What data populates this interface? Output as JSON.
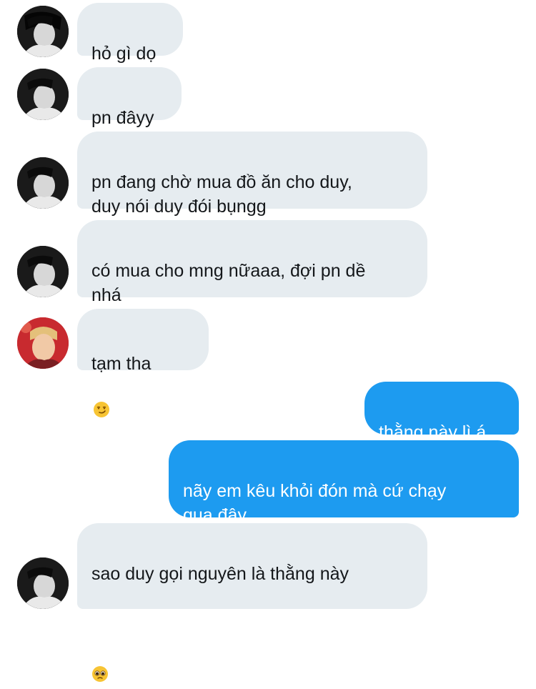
{
  "messages": [
    {
      "sender": "friend_a",
      "text": "hỏ gì dọ"
    },
    {
      "sender": "friend_a",
      "text": "pn đâyy"
    },
    {
      "sender": "friend_a",
      "text": "pn đang chờ mua đồ ăn cho duy,\nduy nói duy đói bụngg"
    },
    {
      "sender": "friend_a",
      "text": "có mua cho mng nữaaa, đợi pn dề\nnhá"
    },
    {
      "sender": "friend_b",
      "text": "tạm tha",
      "emoji": "smirk-emoji"
    },
    {
      "sender": "me",
      "text": "thằng này lì á"
    },
    {
      "sender": "me",
      "text": "nãy em kêu khỏi đón mà cứ chạy\nqua đây"
    },
    {
      "sender": "friend_a",
      "text": "sao duy gọi nguyên là thằng này",
      "emoji": "pleading-emoji"
    }
  ],
  "colors": {
    "incoming_bubble": "#e6ecf0",
    "outgoing_bubble": "#1d9bf0",
    "incoming_text": "#14171a",
    "outgoing_text": "#ffffff"
  }
}
